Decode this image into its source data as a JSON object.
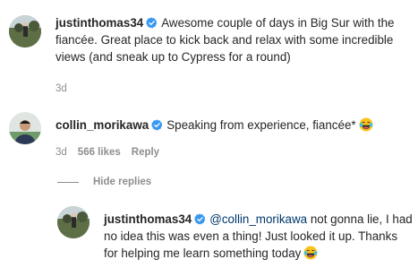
{
  "comments": [
    {
      "username": "justinthomas34",
      "text": "Awesome couple of days in Big Sur with the fiancée. Great place to kick back and relax with some incredible views (and sneak up to Cypress for a round)",
      "time": "3d"
    },
    {
      "username": "collin_morikawa",
      "text": "Speaking from experience, fiancée*",
      "emoji": "laughing-tears-emoji",
      "time": "3d",
      "likes": "566 likes",
      "reply_label": "Reply"
    }
  ],
  "replies_toggle": {
    "label": "Hide replies"
  },
  "reply": {
    "username": "justinthomas34",
    "mention": "@collin_morikawa",
    "text": " not gonna lie, I had no idea this was even a thing! Just looked it up. Thanks for helping me learn something today",
    "emoji": "laughing-tears-emoji"
  },
  "colors": {
    "verified_badge": "#3897f0",
    "meta_text": "#8e8e8e",
    "mention": "#00376b"
  }
}
